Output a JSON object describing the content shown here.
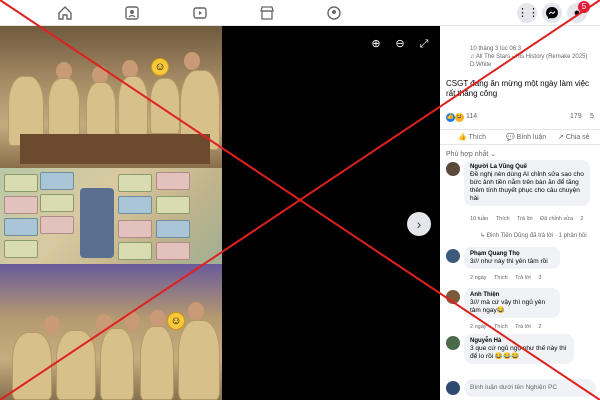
{
  "topbar": {
    "notification_count": "5"
  },
  "viewer": {
    "zoom_in": "⊕",
    "zoom_out": "⊖",
    "fullscreen": "⤢",
    "next": "›"
  },
  "post": {
    "timestamp": "10 tháng 3 lúc 06:3",
    "music": "♫ All The Stars - His History (Remake 2025)",
    "music_artist": "D.White",
    "caption": "CSGT đang ăn mừng một ngày làm việc rất thắng công",
    "reaction_count": "114",
    "comment_count": "179",
    "share_count": "5"
  },
  "actions": {
    "like": "Thích",
    "comment": "Bình luận",
    "share": "Chia sẻ"
  },
  "filter_label": "Phù hợp nhất ⌄",
  "comments": [
    {
      "author": "Người La Vũng Quế",
      "text": "Đề nghị nên dùng AI chỉnh sửa sao cho bức ảnh tiền nằm trên bàn ăn để tăng thêm tính thuyết phục cho câu chuyện hài",
      "time": "10 tuần",
      "like": "Thích",
      "reply": "Trả lời",
      "edited": "Đã chỉnh sửa",
      "reaction": "2",
      "reply_summary": "Đinh Tiến Dũng đã trả lời · 1 phản hồi"
    },
    {
      "author": "Phạm Quang Thọ",
      "text": "3/// như này thì yên tâm rồi",
      "time": "2 ngày",
      "like": "Thích",
      "reply": "Trả lời",
      "reaction": "3"
    },
    {
      "author": "Anh Thiện",
      "text": "3/// mà cứ vậy thì ngủ yên tâm ngay😂",
      "time": "2 ngày",
      "like": "Thích",
      "reply": "Trả lời",
      "reaction": "2"
    },
    {
      "author": "Nguyễn Hà",
      "text": "3 que cứ ngủ ngụ như thế này thì để lo rồi 😂😂😂",
      "time": "2 ngày",
      "like": "Thích",
      "reply": "Trả lời"
    }
  ],
  "compose_placeholder": "Bình luận dưới tên Nghiện PC",
  "colors": {
    "overlay_x": "#e02020",
    "accent": "#1877f2",
    "like_blue": "#1877f2",
    "haha_yellow": "#f7b125"
  }
}
